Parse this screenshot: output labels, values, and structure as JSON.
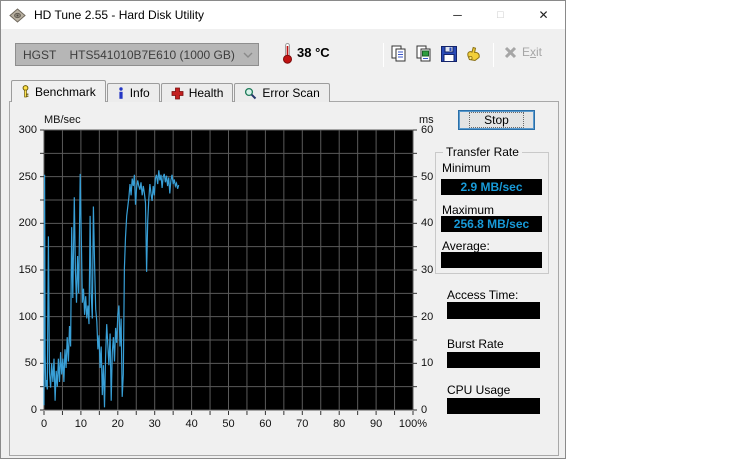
{
  "window": {
    "title": "HD Tune 2.55 - Hard Disk Utility",
    "controls": {
      "minimize": "─",
      "maximize": "□",
      "close": "✕"
    }
  },
  "toolbar": {
    "drive_select": {
      "value": "HGST    HTS541010B7E610 (1000 GB)"
    },
    "temperature": {
      "display": "38 °C"
    },
    "icons": [
      "thermometer-icon",
      "copy-icon",
      "copy-image-icon",
      "save-icon",
      "hand-icon",
      "exit-icon"
    ],
    "exit": {
      "pre": "E",
      "key": "x",
      "post": "it"
    }
  },
  "tabs": [
    {
      "label": "Benchmark",
      "active": true
    },
    {
      "label": "Info",
      "active": false
    },
    {
      "label": "Health",
      "active": false
    },
    {
      "label": "Error Scan",
      "active": false
    }
  ],
  "panel": {
    "stop_label": "Stop",
    "transfer_rate": {
      "title": "Transfer Rate",
      "minimum_label": "Minimum",
      "minimum_value": "2.9 MB/sec",
      "maximum_label": "Maximum",
      "maximum_value": "256.8 MB/sec",
      "average_label": "Average:",
      "average_value": ""
    },
    "access_time_label": "Access Time:",
    "access_time_value": "",
    "burst_rate_label": "Burst Rate",
    "burst_rate_value": "",
    "cpu_usage_label": "CPU Usage",
    "cpu_usage_value": ""
  },
  "chart_data": {
    "type": "line",
    "title": "HD Tune benchmark transfer rate (in progress, ~37% complete)",
    "background": "#000000",
    "grid_color": "#5a5a5a",
    "x_axis": {
      "min": 0,
      "max": 100,
      "label_step": 10,
      "grid_step": 5,
      "suffix": "%"
    },
    "y_left": {
      "min": 0,
      "max": 300,
      "label_step": 50,
      "grid_step": 25,
      "unit": "MB/sec"
    },
    "y_right": {
      "min": 0,
      "max": 60,
      "label_step": 10,
      "unit": "ms"
    },
    "legend_position": "none",
    "series": [
      {
        "name": "Transfer Rate (MB/sec)",
        "color": "#389fd6",
        "points": [
          [
            0,
            5
          ],
          [
            0.15,
            252
          ],
          [
            0.3,
            60
          ],
          [
            0.5,
            25
          ],
          [
            0.7,
            32
          ],
          [
            0.9,
            22
          ],
          [
            1.2,
            186
          ],
          [
            1.5,
            40
          ],
          [
            1.8,
            24
          ],
          [
            2.1,
            50
          ],
          [
            2.4,
            30
          ],
          [
            2.7,
            55
          ],
          [
            3,
            10
          ],
          [
            3.3,
            42
          ],
          [
            3.6,
            25
          ],
          [
            3.9,
            55
          ],
          [
            4.2,
            30
          ],
          [
            4.5,
            62
          ],
          [
            4.8,
            38
          ],
          [
            5.1,
            55
          ],
          [
            5.4,
            30
          ],
          [
            5.7,
            65
          ],
          [
            6,
            45
          ],
          [
            6.3,
            78
          ],
          [
            6.6,
            52
          ],
          [
            6.9,
            90
          ],
          [
            7.2,
            68
          ],
          [
            7.5,
            196
          ],
          [
            7.8,
            120
          ],
          [
            8.2,
            228
          ],
          [
            8.5,
            150
          ],
          [
            8.8,
            115
          ],
          [
            9.1,
            165
          ],
          [
            9.4,
            125
          ],
          [
            9.8,
            253
          ],
          [
            10.1,
            185
          ],
          [
            10.4,
            115
          ],
          [
            10.7,
            130
          ],
          [
            11,
            102
          ],
          [
            11.3,
            122
          ],
          [
            11.6,
            98
          ],
          [
            11.9,
            112
          ],
          [
            12.2,
            92
          ],
          [
            12.5,
            208
          ],
          [
            12.8,
            125
          ],
          [
            13.1,
            98
          ],
          [
            13.4,
            218
          ],
          [
            13.7,
            155
          ],
          [
            14,
            108
          ],
          [
            14.3,
            95
          ],
          [
            14.6,
            65
          ],
          [
            14.9,
            80
          ],
          [
            15.2,
            45
          ],
          [
            15.5,
            68
          ],
          [
            15.8,
            16
          ],
          [
            16.1,
            48
          ],
          [
            16.4,
            2.9
          ],
          [
            16.7,
            58
          ],
          [
            17,
            92
          ],
          [
            17.3,
            70
          ],
          [
            17.6,
            48
          ],
          [
            17.9,
            82
          ],
          [
            18.2,
            10
          ],
          [
            18.5,
            62
          ],
          [
            18.8,
            78
          ],
          [
            19.1,
            52
          ],
          [
            19.4,
            88
          ],
          [
            19.7,
            72
          ],
          [
            20,
            102
          ],
          [
            20.3,
            112
          ],
          [
            20.6,
            68
          ],
          [
            20.9,
            98
          ],
          [
            21.2,
            14
          ],
          [
            21.5,
            38
          ],
          [
            21.8,
            152
          ],
          [
            22.1,
            185
          ],
          [
            22.4,
            208
          ],
          [
            22.7,
            218
          ],
          [
            23,
            228
          ],
          [
            23.3,
            242
          ],
          [
            23.6,
            230
          ],
          [
            23.9,
            248
          ],
          [
            24.2,
            240
          ],
          [
            24.5,
            252
          ],
          [
            24.8,
            220
          ],
          [
            25.1,
            238
          ],
          [
            25.4,
            246
          ],
          [
            25.7,
            240
          ],
          [
            26,
            236
          ],
          [
            26.3,
            244
          ],
          [
            26.6,
            230
          ],
          [
            26.9,
            240
          ],
          [
            27.2,
            232
          ],
          [
            27.5,
            222
          ],
          [
            27.8,
            148
          ],
          [
            28.1,
            202
          ],
          [
            28.4,
            226
          ],
          [
            28.7,
            242
          ],
          [
            29,
            232
          ],
          [
            29.3,
            224
          ],
          [
            29.6,
            240
          ],
          [
            29.9,
            230
          ],
          [
            30.2,
            248
          ],
          [
            30.5,
            252
          ],
          [
            30.8,
            242
          ],
          [
            31.1,
            256.8
          ],
          [
            31.4,
            246
          ],
          [
            31.7,
            252
          ],
          [
            32,
            238
          ],
          [
            32.3,
            250
          ],
          [
            32.6,
            253
          ],
          [
            32.9,
            244
          ],
          [
            33.2,
            251
          ],
          [
            33.5,
            240
          ],
          [
            33.8,
            249
          ],
          [
            34.1,
            232
          ],
          [
            34.4,
            246
          ],
          [
            34.7,
            252
          ],
          [
            35,
            242
          ],
          [
            35.3,
            247
          ],
          [
            35.6,
            240
          ],
          [
            35.9,
            243
          ],
          [
            36.2,
            237
          ],
          [
            36.5,
            241
          ]
        ]
      }
    ]
  },
  "colors": {
    "value_text": "#189ad8",
    "line": "#389fd6",
    "plot_background": "#000000",
    "grid": "#5a5a5a",
    "combo_background": "#b6b6b6"
  }
}
